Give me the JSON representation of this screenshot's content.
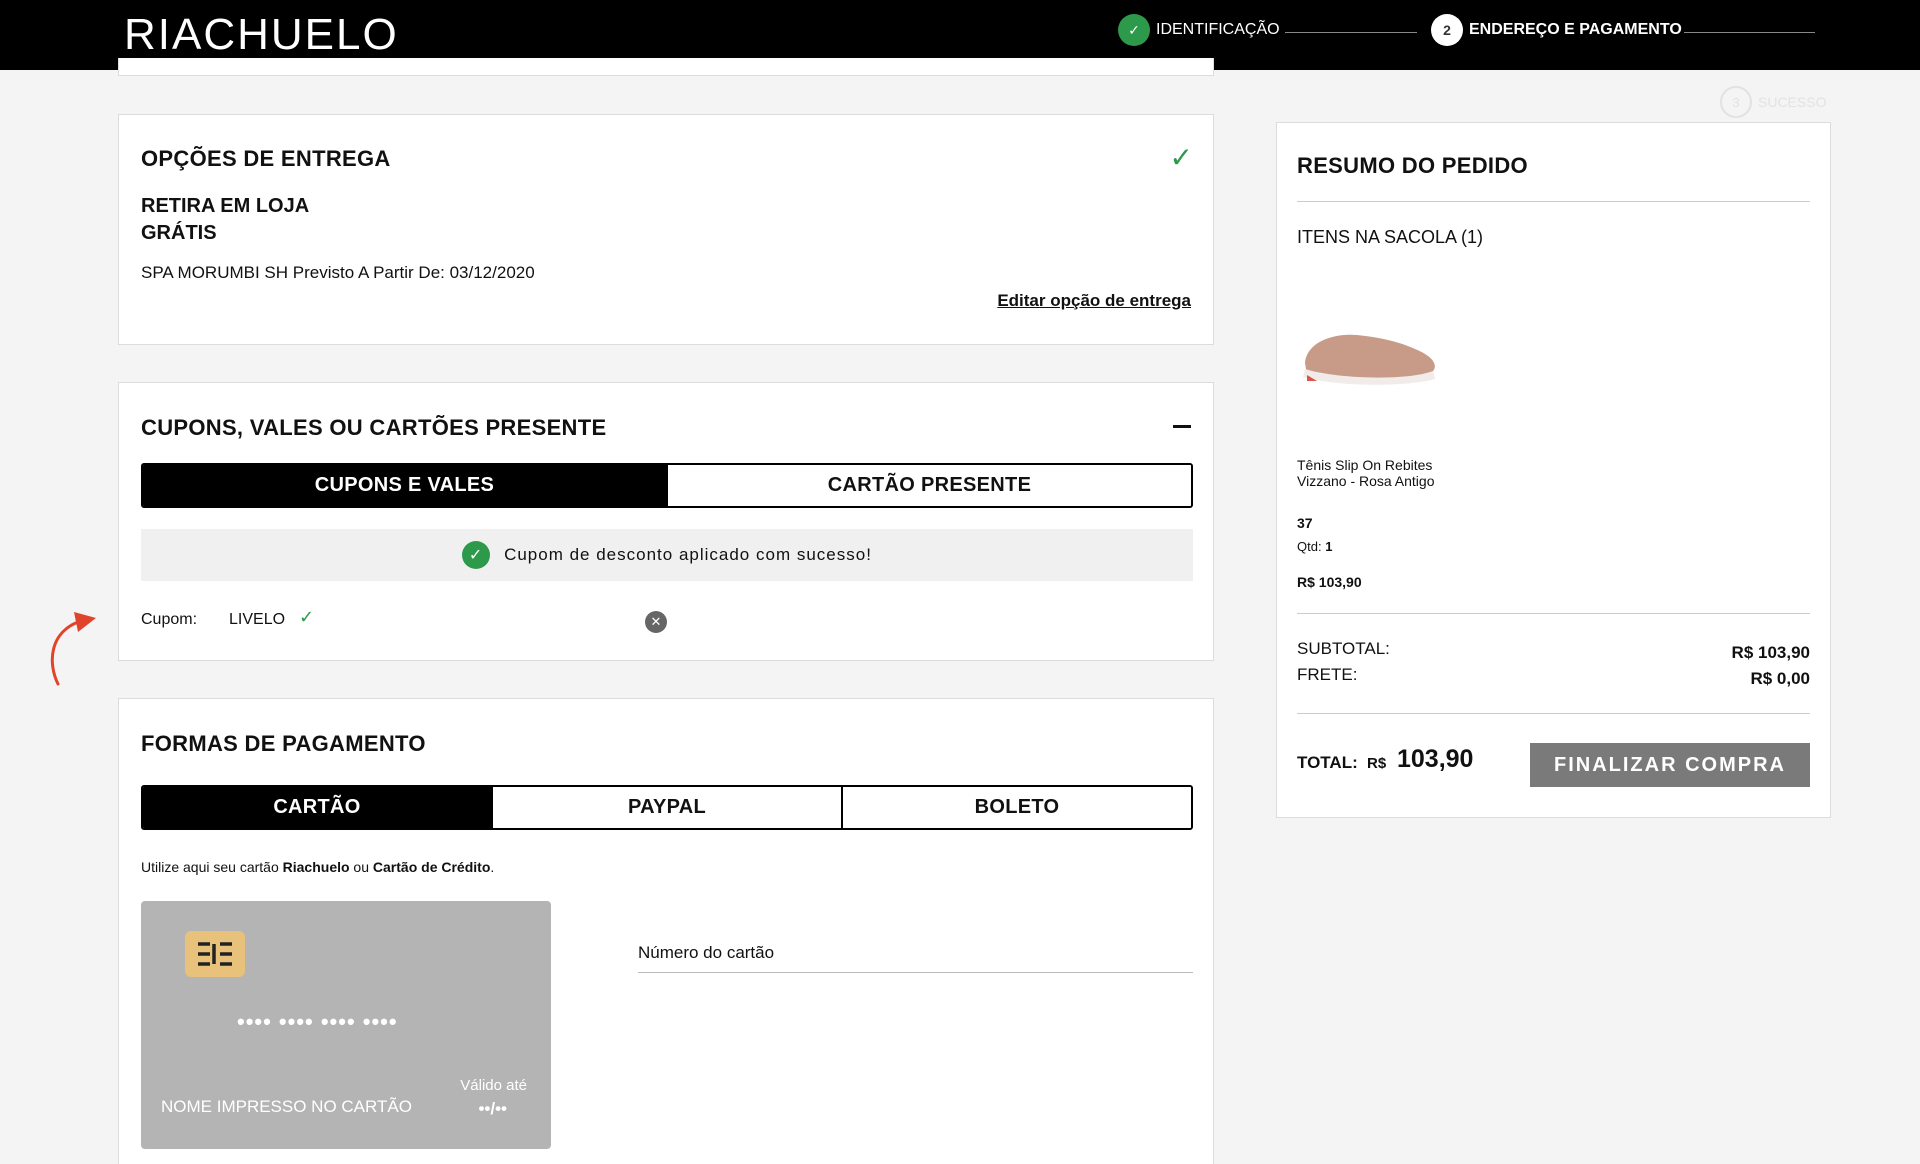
{
  "header": {
    "logo": "RIACHUELO",
    "steps": [
      {
        "number": "",
        "label": "IDENTIFICAÇÃO",
        "status": "done"
      },
      {
        "number": "2",
        "label": "ENDEREÇO E PAGAMENTO",
        "status": "current"
      },
      {
        "number": "3",
        "label": "SUCESSO",
        "status": "pending"
      }
    ]
  },
  "delivery": {
    "title": "OPÇÕES DE ENTREGA",
    "method": "RETIRA EM LOJA",
    "price": "GRÁTIS",
    "address": "SPA MORUMBI SH Previsto A Partir De: 03/12/2020",
    "edit_link": "Editar opção de entrega"
  },
  "coupons": {
    "title": "CUPONS, VALES OU CARTÕES PRESENTE",
    "tabs": [
      {
        "label": "CUPONS E VALES",
        "active": true
      },
      {
        "label": "CARTÃO PRESENTE",
        "active": false
      }
    ],
    "success_message": "Cupom de desconto aplicado com sucesso!",
    "coupon_label": "Cupom:",
    "coupon_code": "LIVELO"
  },
  "payment": {
    "title": "FORMAS DE PAGAMENTO",
    "tabs": [
      {
        "label": "CARTÃO",
        "active": true
      },
      {
        "label": "PAYPAL",
        "active": false
      },
      {
        "label": "BOLETO",
        "active": false
      }
    ],
    "note_prefix": "Utilize aqui seu cartão ",
    "note_brand": "Riachuelo",
    "note_mid": " ou ",
    "note_credit": "Cartão de Crédito",
    "note_suffix": ".",
    "card": {
      "number_mask": "•••• •••• •••• ••••",
      "name_placeholder": "NOME IMPRESSO NO CARTÃO",
      "valid_label": "Válido até",
      "valid_mask": "••/••"
    },
    "card_number_label": "Número do cartão"
  },
  "summary": {
    "title": "RESUMO DO PEDIDO",
    "items_label": "ITENS NA SACOLA (1)",
    "product": {
      "name": "Tênis Slip On Rebites Vizzano - Rosa Antigo",
      "size": "37",
      "qty_label": "Qtd:",
      "qty": "1",
      "price": "R$ 103,90"
    },
    "subtotal_label": "SUBTOTAL:",
    "subtotal_value": "R$ 103,90",
    "shipping_label": "FRETE:",
    "shipping_value": "R$ 0,00",
    "total_label": "TOTAL:",
    "total_currency": "R$",
    "total_value": "103,90",
    "finalize_button": "FINALIZAR COMPRA"
  },
  "colors": {
    "accent_green": "#2c9a4a",
    "header_bg": "#000000",
    "button_disabled": "#7a7a7a"
  }
}
